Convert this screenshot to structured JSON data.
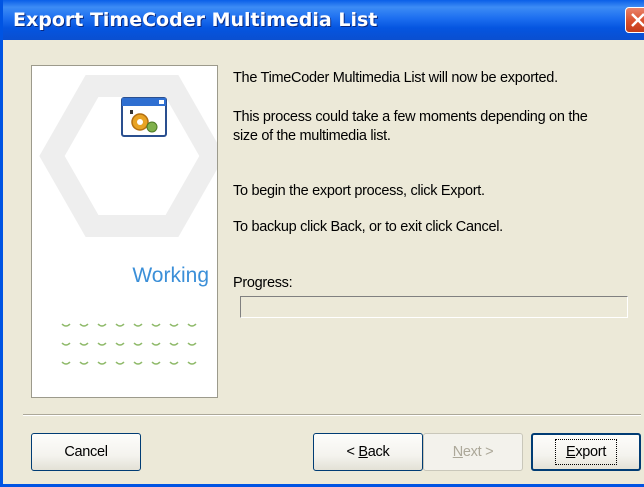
{
  "window": {
    "title": "Export TimeCoder Multimedia List"
  },
  "side_panel": {
    "status": "Working",
    "icon": "gear-window-icon"
  },
  "content": {
    "line1": "The TimeCoder Multimedia List will now be exported.",
    "line2a": "This process could take a few moments depending on the",
    "line2b": "size of the multimedia list.",
    "line3": "To begin the export process, click Export.",
    "line4": "To backup click Back, or to exit click Cancel.",
    "progress_label": "Progress:",
    "progress": 0
  },
  "buttons": {
    "cancel": "Cancel",
    "back_prefix": "< ",
    "back_key": "B",
    "back_rest": "ack",
    "next_key": "N",
    "next_rest": "ext >",
    "export_key": "E",
    "export_rest": "xport"
  },
  "colors": {
    "title_bar": "#0a5fe8",
    "working_text": "#3b8fd8",
    "dialog_bg": "#ece9d8"
  }
}
